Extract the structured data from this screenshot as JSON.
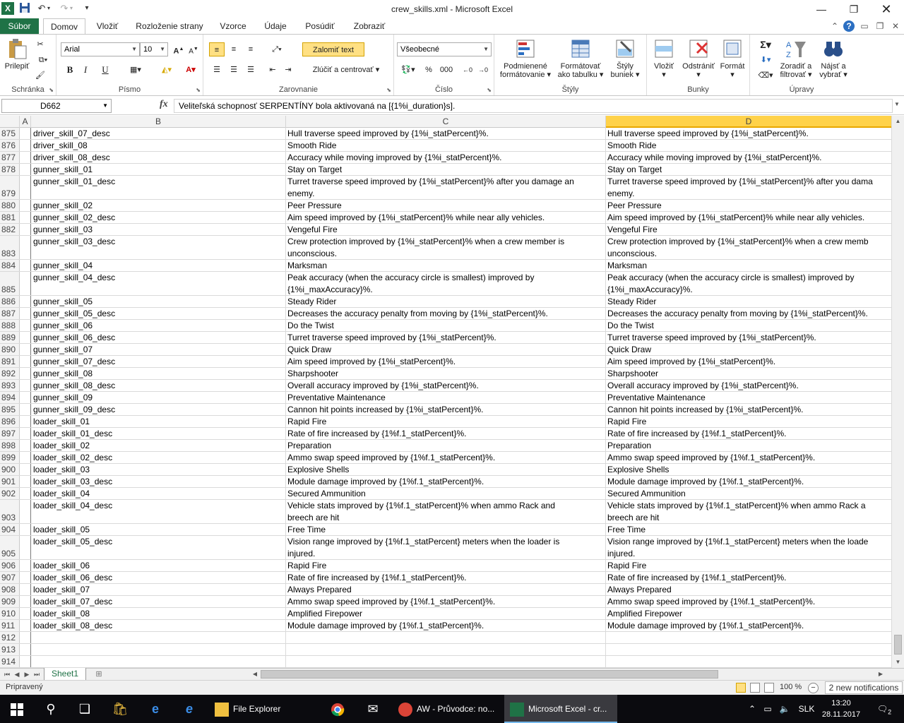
{
  "window": {
    "title": "crew_skills.xml  -  Microsoft Excel"
  },
  "qat": {
    "logo": "X"
  },
  "tabs": {
    "file": "Súbor",
    "items": [
      "Domov",
      "Vložiť",
      "Rozloženie strany",
      "Vzorce",
      "Údaje",
      "Posúdiť",
      "Zobraziť"
    ]
  },
  "ribbon": {
    "clipboard": {
      "title": "Schránka",
      "paste": "Prilepiť"
    },
    "font": {
      "title": "Písmo",
      "name": "Arial",
      "size": "10",
      "bold": "B",
      "italic": "I",
      "underline": "U"
    },
    "alignment": {
      "title": "Zarovnanie",
      "wrap": "Zalomiť text",
      "merge": "Zlúčiť a centrovať"
    },
    "number": {
      "title": "Číslo",
      "format": "Všeobecné",
      "percent": "%",
      "thousands": "000"
    },
    "styles": {
      "title": "Štýly",
      "conditional": [
        "Podmienené",
        "formátovanie"
      ],
      "table": [
        "Formátovať",
        "ako tabulku"
      ],
      "cell": [
        "Štýly",
        "buniek"
      ]
    },
    "cells": {
      "title": "Bunky",
      "insert": "Vložiť",
      "delete": "Odstrániť",
      "format": "Formát"
    },
    "editing": {
      "title": "Úpravy",
      "sort": [
        "Zoradiť a",
        "filtrovať"
      ],
      "find": [
        "Nájsť a",
        "vybrať"
      ],
      "sigma": "Σ"
    }
  },
  "formula_bar": {
    "name_box": "D662",
    "fx": "fx",
    "content": "Veliteľská schopnosť SERPENTÍNY bola aktivovaná na [{1%i_duration}s]."
  },
  "columns": [
    "A",
    "B",
    "C",
    "D"
  ],
  "rows": [
    {
      "n": "875",
      "b": "driver_skill_07_desc",
      "c": [
        "Hull traverse speed improved by {1%i_statPercent}%."
      ],
      "d": [
        "Hull traverse speed improved by {1%i_statPercent}%."
      ]
    },
    {
      "n": "876",
      "b": "driver_skill_08",
      "c": [
        "Smooth Ride"
      ],
      "d": [
        "Smooth Ride"
      ]
    },
    {
      "n": "877",
      "b": "driver_skill_08_desc",
      "c": [
        "Accuracy while moving improved by {1%i_statPercent}%."
      ],
      "d": [
        "Accuracy while moving improved by {1%i_statPercent}%."
      ]
    },
    {
      "n": "878",
      "b": "gunner_skill_01",
      "c": [
        "Stay on Target"
      ],
      "d": [
        "Stay on Target"
      ]
    },
    {
      "n": "879",
      "b": "gunner_skill_01_desc",
      "c": [
        "Turret traverse speed improved by {1%i_statPercent}% after you damage an",
        "enemy."
      ],
      "d": [
        "Turret traverse speed improved by {1%i_statPercent}% after you dama",
        "enemy."
      ]
    },
    {
      "n": "880",
      "b": "gunner_skill_02",
      "c": [
        "Peer Pressure"
      ],
      "d": [
        "Peer Pressure"
      ]
    },
    {
      "n": "881",
      "b": "gunner_skill_02_desc",
      "c": [
        "Aim speed improved by {1%i_statPercent}% while near ally vehicles."
      ],
      "d": [
        "Aim speed improved by {1%i_statPercent}% while near ally vehicles."
      ]
    },
    {
      "n": "882",
      "b": "gunner_skill_03",
      "c": [
        "Vengeful Fire"
      ],
      "d": [
        "Vengeful Fire"
      ]
    },
    {
      "n": "883",
      "b": "gunner_skill_03_desc",
      "c": [
        "Crew protection improved by {1%i_statPercent}% when a crew member is",
        "unconscious."
      ],
      "d": [
        "Crew protection improved by {1%i_statPercent}% when a crew memb",
        "unconscious."
      ]
    },
    {
      "n": "884",
      "b": "gunner_skill_04",
      "c": [
        "Marksman"
      ],
      "d": [
        "Marksman"
      ]
    },
    {
      "n": "885",
      "b": "gunner_skill_04_desc",
      "c": [
        "Peak accuracy (when the accuracy circle is smallest) improved by",
        "{1%i_maxAccuracy}%."
      ],
      "d": [
        "Peak accuracy (when the accuracy circle is smallest) improved by",
        "{1%i_maxAccuracy}%."
      ]
    },
    {
      "n": "886",
      "b": "gunner_skill_05",
      "c": [
        "Steady Rider"
      ],
      "d": [
        "Steady Rider"
      ]
    },
    {
      "n": "887",
      "b": "gunner_skill_05_desc",
      "c": [
        "Decreases the accuracy penalty from moving by {1%i_statPercent}%."
      ],
      "d": [
        "Decreases the accuracy penalty from moving by {1%i_statPercent}%."
      ]
    },
    {
      "n": "888",
      "b": "gunner_skill_06",
      "c": [
        "Do the Twist"
      ],
      "d": [
        "Do the Twist"
      ]
    },
    {
      "n": "889",
      "b": "gunner_skill_06_desc",
      "c": [
        "Turret traverse speed improved by {1%i_statPercent}%."
      ],
      "d": [
        "Turret traverse speed improved by {1%i_statPercent}%."
      ]
    },
    {
      "n": "890",
      "b": "gunner_skill_07",
      "c": [
        "Quick Draw"
      ],
      "d": [
        "Quick Draw"
      ]
    },
    {
      "n": "891",
      "b": "gunner_skill_07_desc",
      "c": [
        "Aim speed improved by {1%i_statPercent}%."
      ],
      "d": [
        "Aim speed improved by {1%i_statPercent}%."
      ]
    },
    {
      "n": "892",
      "b": "gunner_skill_08",
      "c": [
        "Sharpshooter"
      ],
      "d": [
        "Sharpshooter"
      ]
    },
    {
      "n": "893",
      "b": "gunner_skill_08_desc",
      "c": [
        "Overall accuracy improved by {1%i_statPercent}%."
      ],
      "d": [
        "Overall accuracy improved by {1%i_statPercent}%."
      ]
    },
    {
      "n": "894",
      "b": "gunner_skill_09",
      "c": [
        "Preventative Maintenance"
      ],
      "d": [
        "Preventative Maintenance"
      ]
    },
    {
      "n": "895",
      "b": "gunner_skill_09_desc",
      "c": [
        "Cannon hit points increased by {1%i_statPercent}%."
      ],
      "d": [
        "Cannon hit points increased by {1%i_statPercent}%."
      ]
    },
    {
      "n": "896",
      "b": "loader_skill_01",
      "c": [
        "Rapid Fire"
      ],
      "d": [
        "Rapid Fire"
      ]
    },
    {
      "n": "897",
      "b": "loader_skill_01_desc",
      "c": [
        "Rate of fire increased by {1%f.1_statPercent}%."
      ],
      "d": [
        "Rate of fire increased by {1%f.1_statPercent}%."
      ]
    },
    {
      "n": "898",
      "b": "loader_skill_02",
      "c": [
        "Preparation"
      ],
      "d": [
        "Preparation"
      ]
    },
    {
      "n": "899",
      "b": "loader_skill_02_desc",
      "c": [
        "Ammo swap speed improved by {1%f.1_statPercent}%."
      ],
      "d": [
        "Ammo swap speed improved by {1%f.1_statPercent}%."
      ]
    },
    {
      "n": "900",
      "b": "loader_skill_03",
      "c": [
        "Explosive Shells"
      ],
      "d": [
        "Explosive Shells"
      ]
    },
    {
      "n": "901",
      "b": "loader_skill_03_desc",
      "c": [
        "Module damage improved by {1%f.1_statPercent}%."
      ],
      "d": [
        "Module damage improved by {1%f.1_statPercent}%."
      ]
    },
    {
      "n": "902",
      "b": "loader_skill_04",
      "c": [
        "Secured Ammunition"
      ],
      "d": [
        "Secured Ammunition"
      ]
    },
    {
      "n": "903",
      "b": "loader_skill_04_desc",
      "c": [
        "Vehicle stats improved by {1%f.1_statPercent}% when ammo Rack and",
        "breech are hit"
      ],
      "d": [
        "Vehicle stats improved by {1%f.1_statPercent}% when ammo Rack a",
        "breech are hit"
      ]
    },
    {
      "n": "904",
      "b": "loader_skill_05",
      "c": [
        "Free Time"
      ],
      "d": [
        "Free Time"
      ]
    },
    {
      "n": "905",
      "b": "loader_skill_05_desc",
      "c": [
        "Vision range improved by {1%f.1_statPercent} meters when the loader is",
        "injured."
      ],
      "d": [
        "Vision range improved by {1%f.1_statPercent} meters when the loade",
        "injured."
      ]
    },
    {
      "n": "906",
      "b": "loader_skill_06",
      "c": [
        "Rapid Fire"
      ],
      "d": [
        "Rapid Fire"
      ]
    },
    {
      "n": "907",
      "b": "loader_skill_06_desc",
      "c": [
        "Rate of fire increased by {1%f.1_statPercent}%."
      ],
      "d": [
        "Rate of fire increased by {1%f.1_statPercent}%."
      ]
    },
    {
      "n": "908",
      "b": "loader_skill_07",
      "c": [
        "Always Prepared"
      ],
      "d": [
        "Always Prepared"
      ]
    },
    {
      "n": "909",
      "b": "loader_skill_07_desc",
      "c": [
        "Ammo swap speed improved by {1%f.1_statPercent}%."
      ],
      "d": [
        "Ammo swap speed improved by {1%f.1_statPercent}%."
      ]
    },
    {
      "n": "910",
      "b": "loader_skill_08",
      "c": [
        "Amplified Firepower"
      ],
      "d": [
        "Amplified Firepower"
      ]
    },
    {
      "n": "911",
      "b": "loader_skill_08_desc",
      "c": [
        "Module damage improved by {1%f.1_statPercent}%."
      ],
      "d": [
        "Module damage improved by {1%f.1_statPercent}%."
      ]
    },
    {
      "n": "912",
      "b": "",
      "c": [
        ""
      ],
      "d": [
        ""
      ]
    },
    {
      "n": "913",
      "b": "",
      "c": [
        ""
      ],
      "d": [
        ""
      ]
    },
    {
      "n": "914",
      "b": "",
      "c": [
        ""
      ],
      "d": [
        ""
      ]
    }
  ],
  "sheet": {
    "tab": "Sheet1"
  },
  "status": {
    "text": "Pripravený",
    "zoom": "100 %",
    "zoom_minus": "−",
    "notifications": "2 new notifications"
  },
  "taskbar": {
    "apps": [
      {
        "label": "File Explorer"
      },
      {
        "label": "AW - Průvodce: no..."
      },
      {
        "label": "Microsoft Excel - cr..."
      }
    ],
    "lang": "SLK",
    "time": "13:20",
    "date": "28.11.2017",
    "notif_count": "2"
  },
  "colors": {
    "excel_green": "#1f7246",
    "selected_col": "#ffd24a",
    "taskbar": "#0b0b0f"
  }
}
